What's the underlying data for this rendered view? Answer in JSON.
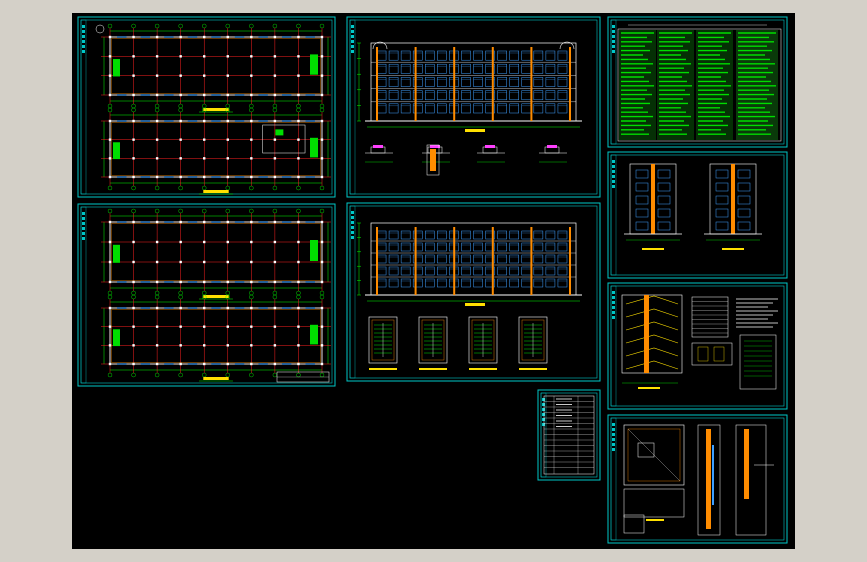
{
  "app": {
    "background": "#d4d0c8",
    "viewport_background": "#000000"
  },
  "colors": {
    "sheet_frame": "#00c8c8",
    "grid_axis": "#ff2020",
    "walls": "#ffffff",
    "dimension": "#00ff00",
    "fill_green": "#00dd00",
    "window_blue": "#3fa0ff",
    "accent_yellow": "#ffe000",
    "accent_orange": "#ff8c00",
    "magenta": "#ff40ff"
  },
  "sheets": [
    {
      "id": "sheet-floor-plan-1-2",
      "kind": "floor-plans"
    },
    {
      "id": "sheet-floor-plan-3-4",
      "kind": "floor-plans"
    },
    {
      "id": "sheet-elevation-front",
      "kind": "elevation-details"
    },
    {
      "id": "sheet-elevation-back",
      "kind": "elevation-stairs"
    },
    {
      "id": "sheet-design-notes",
      "kind": "notes-table"
    },
    {
      "id": "sheet-side-elevations",
      "kind": "side-elevations"
    },
    {
      "id": "sheet-stair-section",
      "kind": "section"
    },
    {
      "id": "sheet-drawing-index",
      "kind": "index-table"
    },
    {
      "id": "sheet-wall-details",
      "kind": "details"
    }
  ],
  "icons": {
    "compass": "north-arrow-icon"
  }
}
